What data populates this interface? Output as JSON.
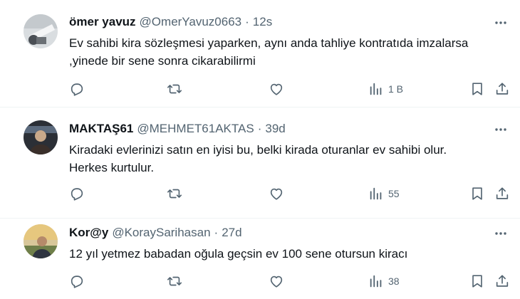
{
  "tweets": [
    {
      "display_name": "ömer yavuz",
      "handle": "@OmerYavuz0663",
      "separator": "·",
      "time": "12s",
      "text_lines": [
        "Ev sahibi kira sözleşmesi yaparken, aynı anda tahliye kontratıda imzalarsa",
        ",yinede bir sene sonra cikarabilirmi"
      ],
      "views": "1 B"
    },
    {
      "display_name": "MAKTAŞ61",
      "handle": "@MEHMET61AKTAS",
      "separator": "·",
      "time": "39d",
      "text_lines": [
        "Kiradaki evlerinizi satın en iyisi bu, belki kirada oturanlar ev sahibi olur.",
        "Herkes kurtulur."
      ],
      "views": "55"
    },
    {
      "display_name": "Kor@y",
      "handle": "@KoraySarihasan",
      "separator": "·",
      "time": "27d",
      "text_lines": [
        "12 yıl yetmez babadan oğula geçsin ev 100 sene otursun kiracı"
      ],
      "views": "38"
    }
  ],
  "icons": {
    "reply": "reply-icon",
    "retweet": "retweet-icon",
    "like": "like-icon",
    "views": "views-icon",
    "bookmark": "bookmark-icon",
    "share": "share-icon",
    "more": "more-icon"
  },
  "colors": {
    "text": "#0f1419",
    "secondary": "#536471",
    "divider": "#eff3f4"
  }
}
